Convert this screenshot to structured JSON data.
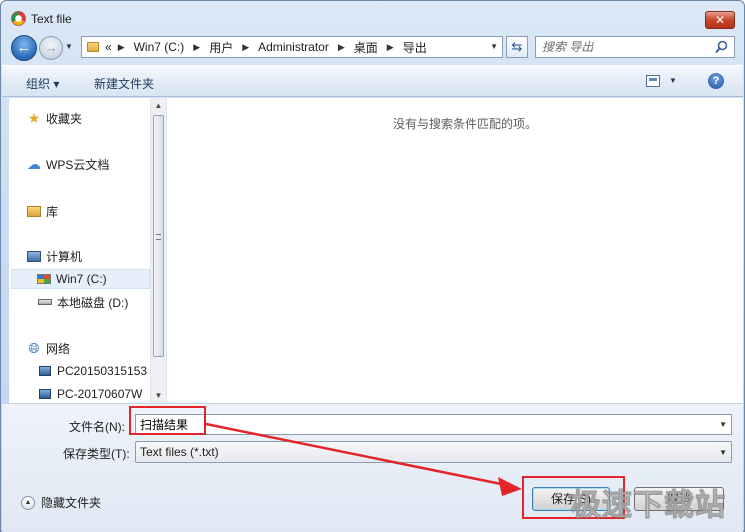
{
  "window": {
    "title": "Text file",
    "close_label": "✕"
  },
  "navigation": {
    "back_glyph": "←",
    "forward_glyph": "→",
    "address": {
      "overflow": "«",
      "crumbs": [
        "Win7 (C:)",
        "用户",
        "Administrator",
        "桌面",
        "导出"
      ]
    },
    "search_placeholder": "搜索 导出"
  },
  "toolbar": {
    "organize_label": "组织 ▾",
    "new_folder_label": "新建文件夹",
    "help_label": "?"
  },
  "nav_pane": {
    "items": [
      {
        "label": "收藏夹",
        "icon": "star-icon"
      },
      {
        "label": "WPS云文档",
        "icon": "cloud-icon"
      },
      {
        "label": "库",
        "icon": "library-icon"
      },
      {
        "label": "计算机",
        "icon": "computer-icon"
      },
      {
        "label": "Win7 (C:)",
        "icon": "system-drive-icon",
        "selected": true
      },
      {
        "label": "本地磁盘 (D:)",
        "icon": "drive-icon"
      },
      {
        "label": "网络",
        "icon": "network-icon"
      },
      {
        "label": "PC20150315153",
        "icon": "network-pc-icon"
      },
      {
        "label": "PC-20170607W",
        "icon": "network-pc-icon"
      }
    ]
  },
  "content": {
    "empty_message": "没有与搜索条件匹配的项。"
  },
  "save_panel": {
    "filename_label": "文件名(N):",
    "filename_value": "扫描结果",
    "filetype_label": "保存类型(T):",
    "filetype_value": "Text files (*.txt)",
    "hide_folders_label": "隐藏文件夹",
    "save_button": "保存(S)",
    "cancel_button": "取消"
  },
  "annotation": {
    "color": "#e3252a"
  },
  "watermark": {
    "text": "极速下载站"
  }
}
